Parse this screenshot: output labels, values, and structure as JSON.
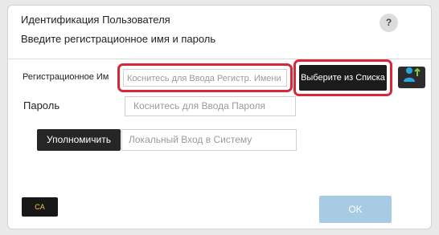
{
  "header": {
    "title": "Идентификация Пользователя",
    "subtitle": "Введите регистрационное имя и пароль",
    "help_label": "?"
  },
  "login": {
    "label": "Регистрационное Им",
    "placeholder": "Коснитесь для Ввода Регистр. Имени",
    "select_button": "Выберите из Списка",
    "user_icon": "user-add-icon"
  },
  "password": {
    "label": "Пароль",
    "placeholder": "Коснитесь для Ввода Пароля"
  },
  "authority": {
    "button": "Уполномичить",
    "field_value": "Локальный Вход в Систему"
  },
  "footer": {
    "ca_button": "CA",
    "ok_button": "OK"
  },
  "colors": {
    "highlight": "#d62839",
    "ok_button": "#a7cbe3",
    "user_icon": "#2ba6e4"
  }
}
